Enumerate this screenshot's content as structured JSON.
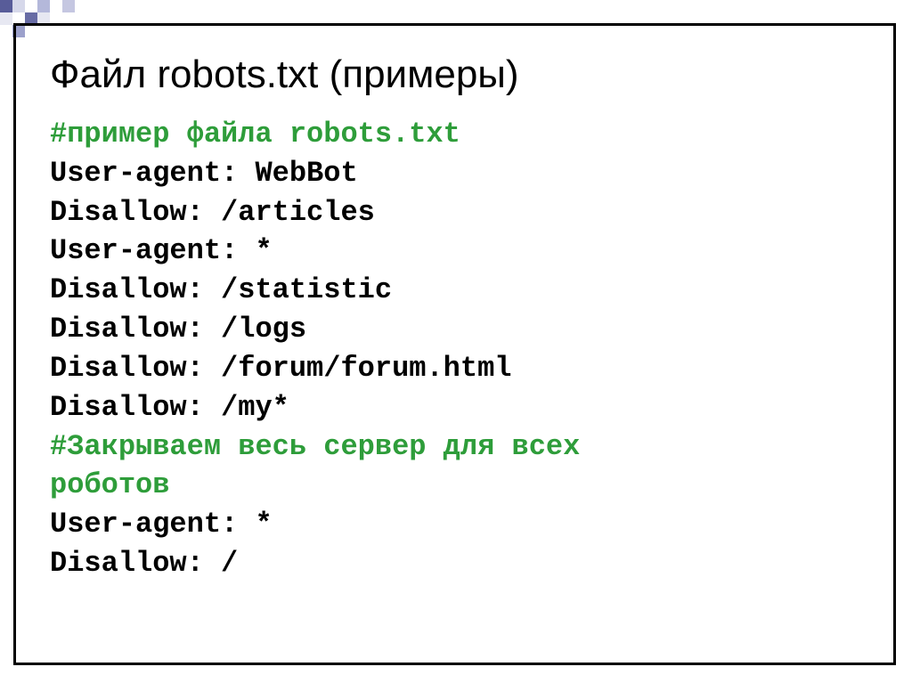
{
  "title": "Файл robots.txt (примеры)",
  "code": {
    "comment1": "#пример файла robots.txt",
    "line1": "User-agent: WebBot",
    "line2": "Disallow: /articles",
    "line3": "User-agent: *",
    "line4": "Disallow: /statistic",
    "line5": "Disallow: /logs",
    "line6": "Disallow: /forum/forum.html",
    "line7": "Disallow: /my*",
    "comment2a": "#Закрываем весь сервер для всех",
    "comment2b": "роботов",
    "line8": "User-agent: *",
    "line9": "Disallow: /"
  }
}
